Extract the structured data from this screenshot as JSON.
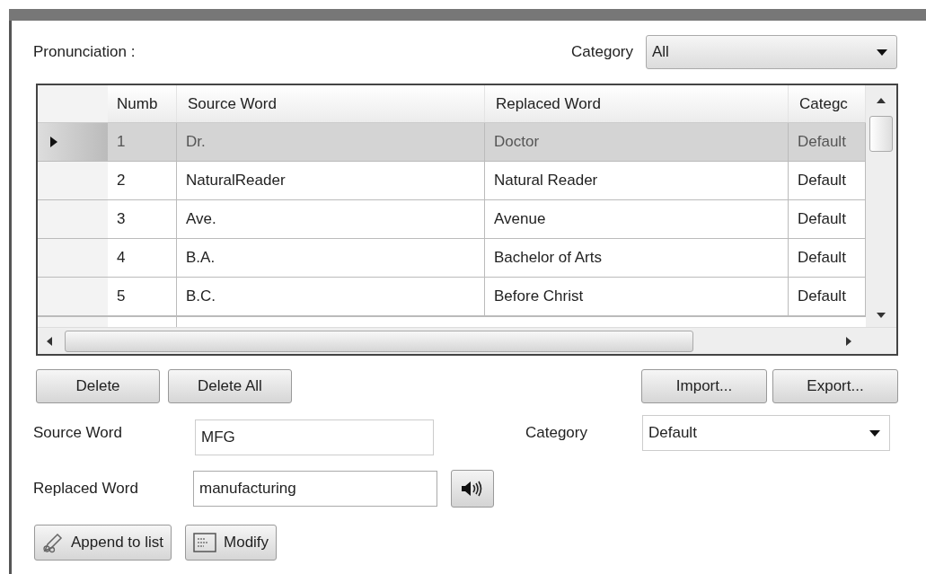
{
  "title": "Pronunciation :",
  "filter": {
    "label": "Category",
    "value": "All"
  },
  "table": {
    "columns": [
      "Numb",
      "Source Word",
      "Replaced Word",
      "Categc"
    ],
    "rows": [
      {
        "cells": [
          "1",
          "Dr.",
          "Doctor",
          "Default"
        ],
        "selected": true
      },
      {
        "cells": [
          "2",
          "NaturalReader",
          "Natural Reader",
          "Default"
        ],
        "selected": false
      },
      {
        "cells": [
          "3",
          "Ave.",
          "Avenue",
          "Default"
        ],
        "selected": false
      },
      {
        "cells": [
          "4",
          "B.A.",
          "Bachelor of Arts",
          "Default"
        ],
        "selected": false
      },
      {
        "cells": [
          "5",
          "B.C.",
          "Before Christ",
          "Default"
        ],
        "selected": false
      }
    ]
  },
  "list_buttons": [
    "Delete",
    "Delete All"
  ],
  "file_buttons": [
    "Import...",
    "Export..."
  ],
  "source_word": {
    "label": "Source Word",
    "value": "MFG"
  },
  "category": {
    "label": "Category",
    "value": "Default"
  },
  "replaced_word": {
    "label": "Replaced Word",
    "value": "manufacturing"
  },
  "action_buttons": [
    {
      "label": "Append to list",
      "kind": "append"
    },
    {
      "label": "Modify",
      "kind": "modify"
    }
  ]
}
